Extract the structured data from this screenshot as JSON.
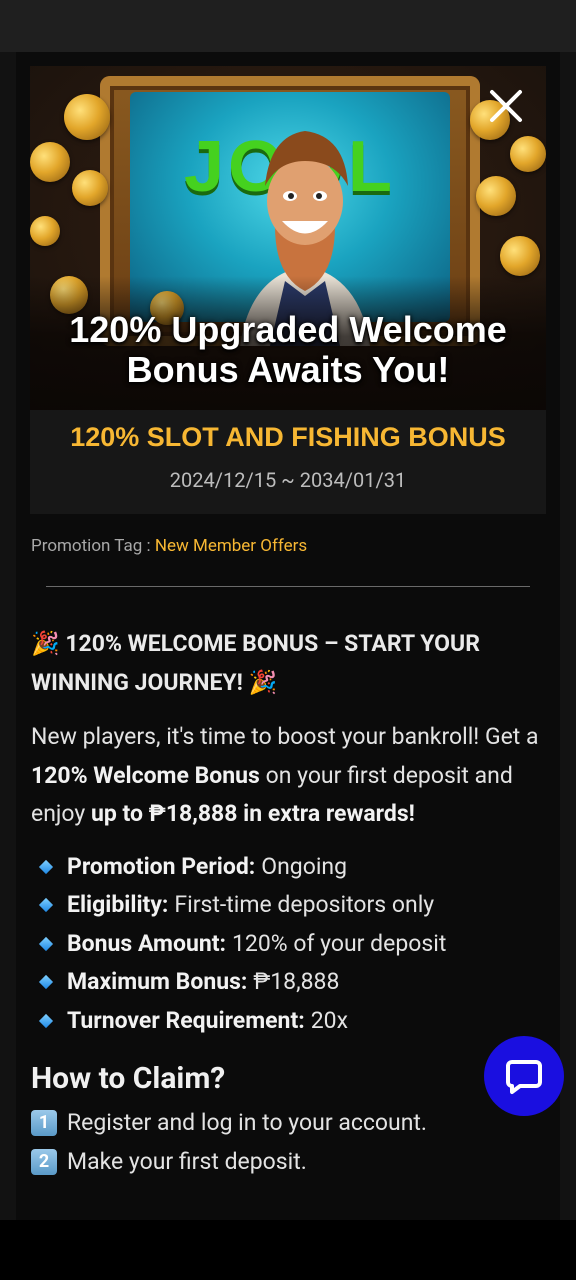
{
  "banner": {
    "image_word": "JOOL",
    "caption_line1": "120% Upgraded Welcome",
    "caption_line2": "Bonus Awaits You!"
  },
  "promo": {
    "title": "120% SLOT AND FISHING BONUS",
    "date_range": "2024/12/15 ~ 2034/01/31",
    "tag_label": "Promotion Tag : ",
    "tag_value": "New Member Offers"
  },
  "content": {
    "headline_emoji_left": "🎉",
    "headline_text": "120% WELCOME BONUS – START YOUR WINNING JOURNEY!",
    "headline_emoji_right": "🎉",
    "para_1": "New players, it's time to boost your bankroll! Get a ",
    "para_bold_1": "120% Welcome Bonus",
    "para_2": " on your first deposit and enjoy ",
    "para_bold_2": "up to ₱18,888 in extra rewards!",
    "details": [
      {
        "label": "Promotion Period:",
        "value": "Ongoing"
      },
      {
        "label": "Eligibility:",
        "value": "First-time depositors only"
      },
      {
        "label": "Bonus Amount:",
        "value": "120% of your deposit"
      },
      {
        "label": "Maximum Bonus:",
        "value": "₱18,888"
      },
      {
        "label": "Turnover Requirement:",
        "value": "20x"
      }
    ],
    "howto_title": "How to Claim?",
    "steps": [
      {
        "num": "1",
        "text": "Register and log in to your account."
      },
      {
        "num": "2",
        "text": "Make your first deposit."
      }
    ]
  },
  "colors": {
    "accent": "#f7b733",
    "chat_button": "#1a0fe0",
    "background": "#0b0b0b"
  },
  "icons": {
    "close": "close-icon",
    "chat": "chat-bubble-icon",
    "bullet": "small-blue-diamond-icon"
  }
}
